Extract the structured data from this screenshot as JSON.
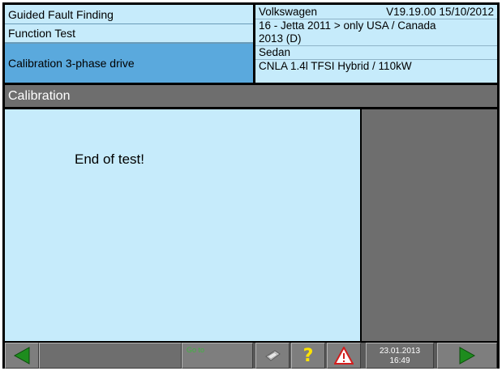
{
  "header": {
    "left": {
      "row1": "Guided Fault Finding",
      "row2": "Function Test",
      "row3": "Calibration 3-phase drive"
    },
    "right": {
      "brand": "Volkswagen",
      "version": "V19.19.00 15/10/2012",
      "model": "16 - Jetta 2011 > only USA / Canada",
      "model_year": "2013 (D)",
      "body": "Sedan",
      "engine": "CNLA 1.4l TFSI Hybrid / 110kW"
    }
  },
  "section": {
    "title": "Calibration"
  },
  "content": {
    "message": "End of test!"
  },
  "toolbar": {
    "goto_label": "Go to",
    "date": "23.01.2013",
    "time": "16:49",
    "icons": {
      "back": "arrow-left-icon",
      "print": "printer-icon",
      "help": "question-mark-icon",
      "warning": "warning-triangle-icon",
      "next": "arrow-right-icon"
    }
  },
  "colors": {
    "panel_light": "#c6ebfb",
    "panel_selected": "#5aa9dd",
    "gray_bar": "#6e6e6e",
    "arrow_green": "#1e8c1e",
    "help_yellow": "#ffe400",
    "warning_red": "#d21e1e"
  }
}
